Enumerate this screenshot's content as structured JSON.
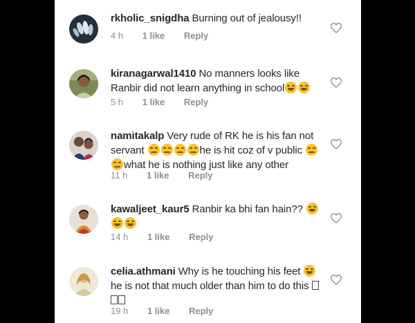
{
  "comments": [
    {
      "username": "rkholic_snigdha",
      "text": "Burning out of jealousy!!",
      "time": "4 h",
      "likes": "1 like",
      "reply": "Reply"
    },
    {
      "username": "kiranagarwal1410",
      "text": "No manners looks like Ranbir did not learn anything in school",
      "time": "5 h",
      "likes": "1 like",
      "reply": "Reply"
    },
    {
      "username": "namitakalp",
      "text_part1": "Very rude of RK he is his fan not servant",
      "text_part2": "he is hit coz of v public",
      "text_part3": "what he is nothing just like any other",
      "time": "11 h",
      "likes": "1 like",
      "reply": "Reply"
    },
    {
      "username": "kawaljeet_kaur5",
      "text": "Ranbir ka bhi fan hain??",
      "time": "14 h",
      "likes": "1 like",
      "reply": "Reply"
    },
    {
      "username": "celia.athmani",
      "text_part1": "Why is he touching his  feet",
      "text_part2": "he is not that much older than him to do this",
      "time": "19 h",
      "likes": "1 like",
      "reply": "Reply"
    }
  ],
  "colors": {
    "username": "#262626",
    "meta": "#8e8e8e",
    "emoji": "#f7c22b",
    "background": "#000000",
    "panel": "#ffffff"
  },
  "icons": [
    "heart-icon",
    "laugh-emoji",
    "sad-emoji"
  ]
}
